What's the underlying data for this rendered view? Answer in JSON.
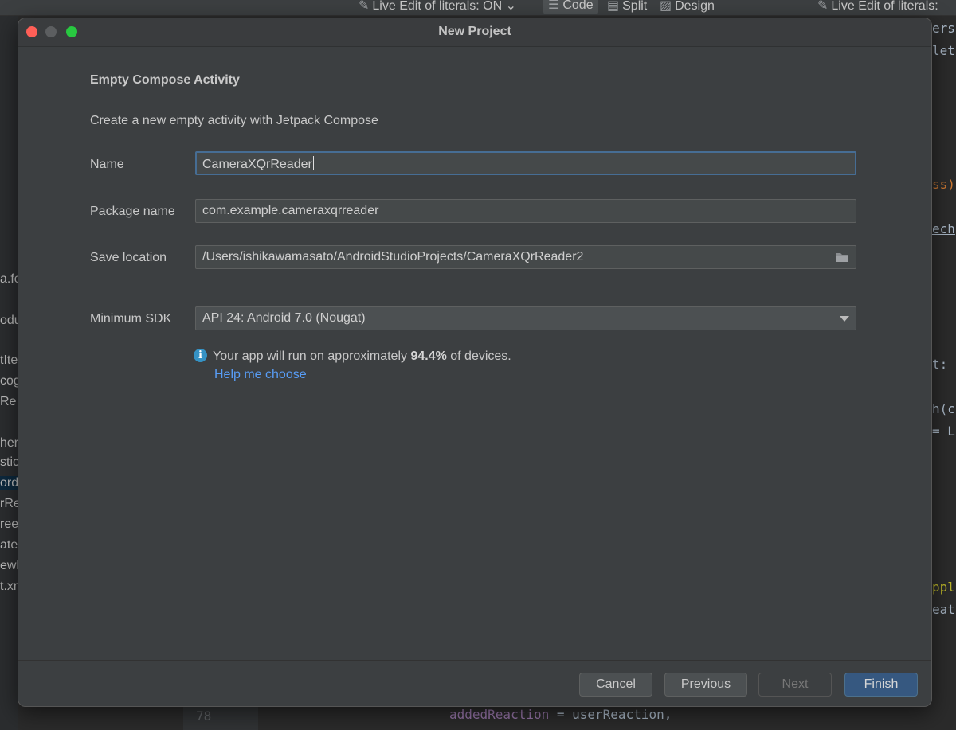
{
  "ide": {
    "toolbar": {
      "live_edit": "Live Edit of literals: ON",
      "code": "Code",
      "split": "Split",
      "design": "Design",
      "live_edit_right": "Live Edit of literals:"
    },
    "left_fragments": [
      "a.fe",
      "odu",
      "tIte",
      "cog",
      "Re",
      "her",
      "stic",
      "ord",
      "rRe",
      "ree",
      "ate",
      "ewl",
      "t.xr"
    ],
    "right_fragments": [
      "ers",
      "let",
      "ss)",
      "ech",
      "t:",
      "h(c",
      "= L",
      "ppl",
      "eat"
    ],
    "bottom": {
      "line_number": "78",
      "variable": "addedReaction",
      "rest": " = userReaction,"
    }
  },
  "dialog": {
    "title": "New Project",
    "heading": "Empty Compose Activity",
    "description": "Create a new empty activity with Jetpack Compose",
    "name": {
      "label": "Name",
      "value": "CameraXQrReader"
    },
    "package": {
      "label": "Package name",
      "value": "com.example.cameraxqrreader"
    },
    "save_location": {
      "label": "Save location",
      "value": "/Users/ishikawamasato/AndroidStudioProjects/CameraXQrReader2"
    },
    "min_sdk": {
      "label": "Minimum SDK",
      "value": "API 24: Android 7.0 (Nougat)"
    },
    "info": {
      "prefix": "Your app will run on approximately ",
      "percent": "94.4%",
      "suffix": " of devices."
    },
    "help_link": "Help me choose",
    "buttons": {
      "cancel": "Cancel",
      "previous": "Previous",
      "next": "Next",
      "finish": "Finish"
    }
  },
  "colors": {
    "accent_focus": "#466d94",
    "primary_button": "#365880",
    "link": "#589df6",
    "info_icon": "#3592c4"
  }
}
